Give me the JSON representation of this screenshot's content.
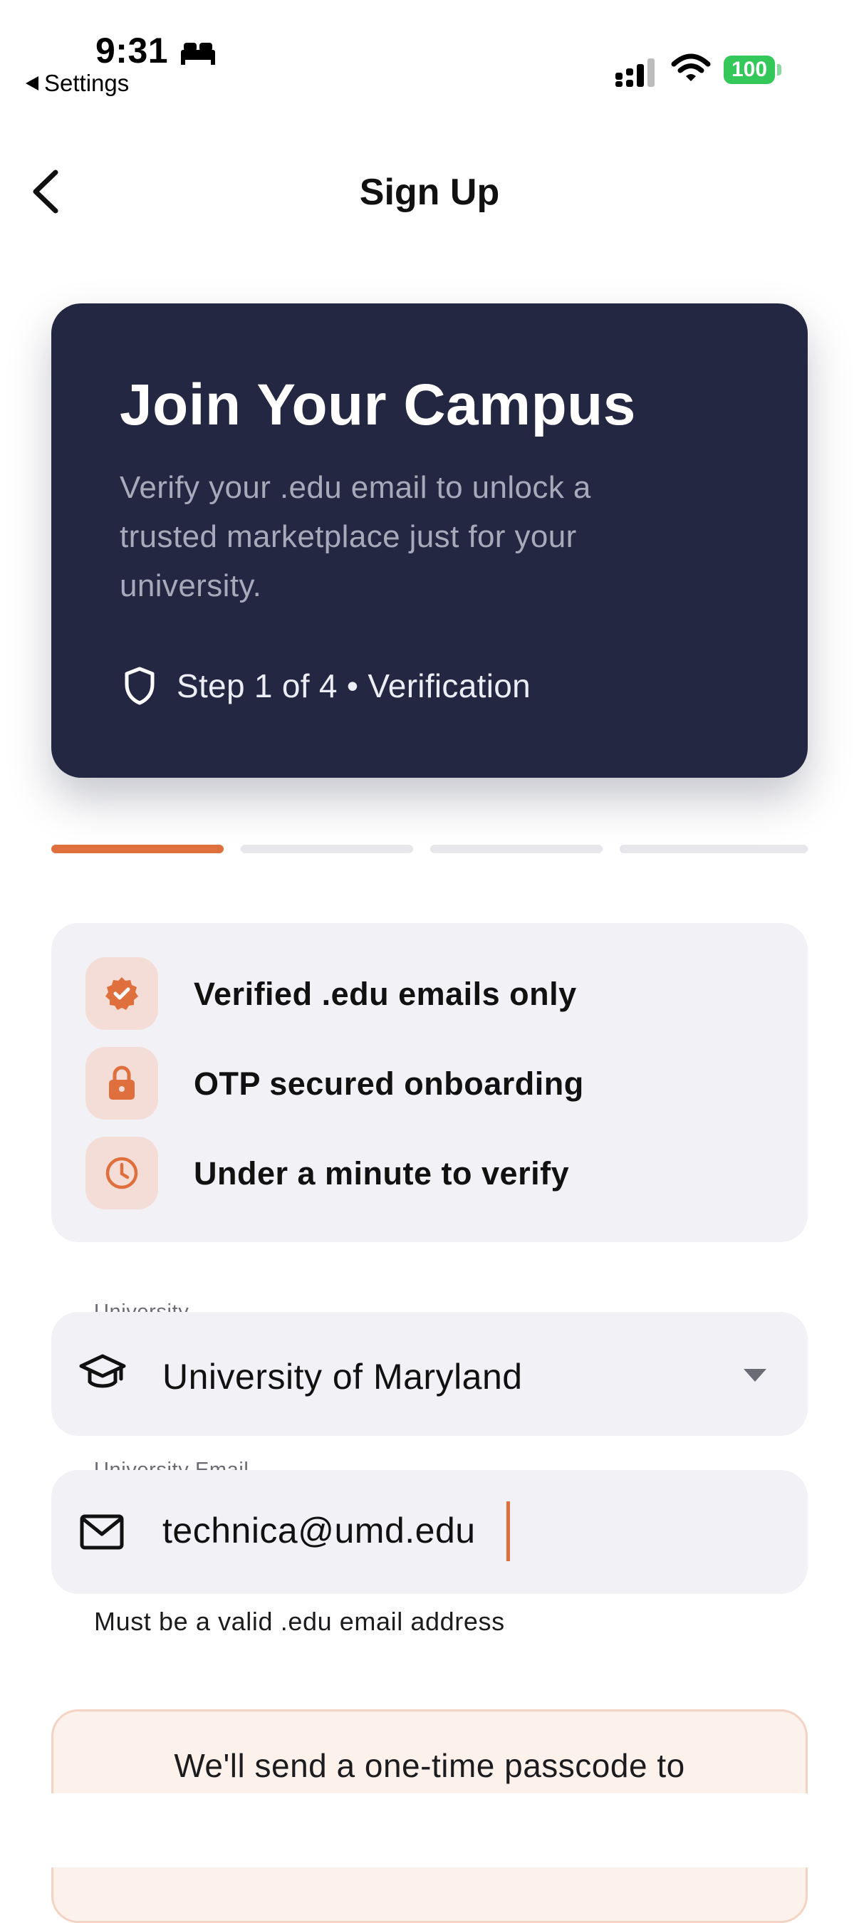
{
  "status_bar": {
    "time": "9:31",
    "back_app": "Settings",
    "battery": "100",
    "icons": [
      "sleep-icon",
      "cellular-signal-icon",
      "wifi-icon",
      "battery-icon"
    ]
  },
  "nav": {
    "title": "Sign Up",
    "back_icon": "chevron-left-icon"
  },
  "hero": {
    "title": "Join Your Campus",
    "subtitle_lines": [
      "Verify your .edu email to unlock a",
      "trusted marketplace just for your",
      "university."
    ],
    "step_text": "Step 1 of 4 • Verification",
    "step_icon": "shield-icon"
  },
  "progress": {
    "current_step": 1,
    "total_steps": 4
  },
  "features": [
    {
      "label": "Verified .edu emails only",
      "icon": "verified-badge-icon"
    },
    {
      "label": "OTP secured onboarding",
      "icon": "lock-icon"
    },
    {
      "label": "Under a minute to verify",
      "icon": "clock-icon"
    }
  ],
  "form": {
    "university": {
      "label": "University",
      "value": "University of Maryland",
      "icon": "graduation-cap-icon",
      "dropdown_icon": "caret-down-icon"
    },
    "email": {
      "label": "University Email",
      "value": "technica@umd.edu",
      "icon": "mail-icon",
      "helper": "Must be a valid .edu email address"
    }
  },
  "notice": {
    "text": "We'll send a one-time passcode to"
  },
  "colors": {
    "accent": "#e06f3e",
    "hero_bg": "#242742",
    "surface": "#f2f1f6",
    "battery": "#34c759"
  }
}
